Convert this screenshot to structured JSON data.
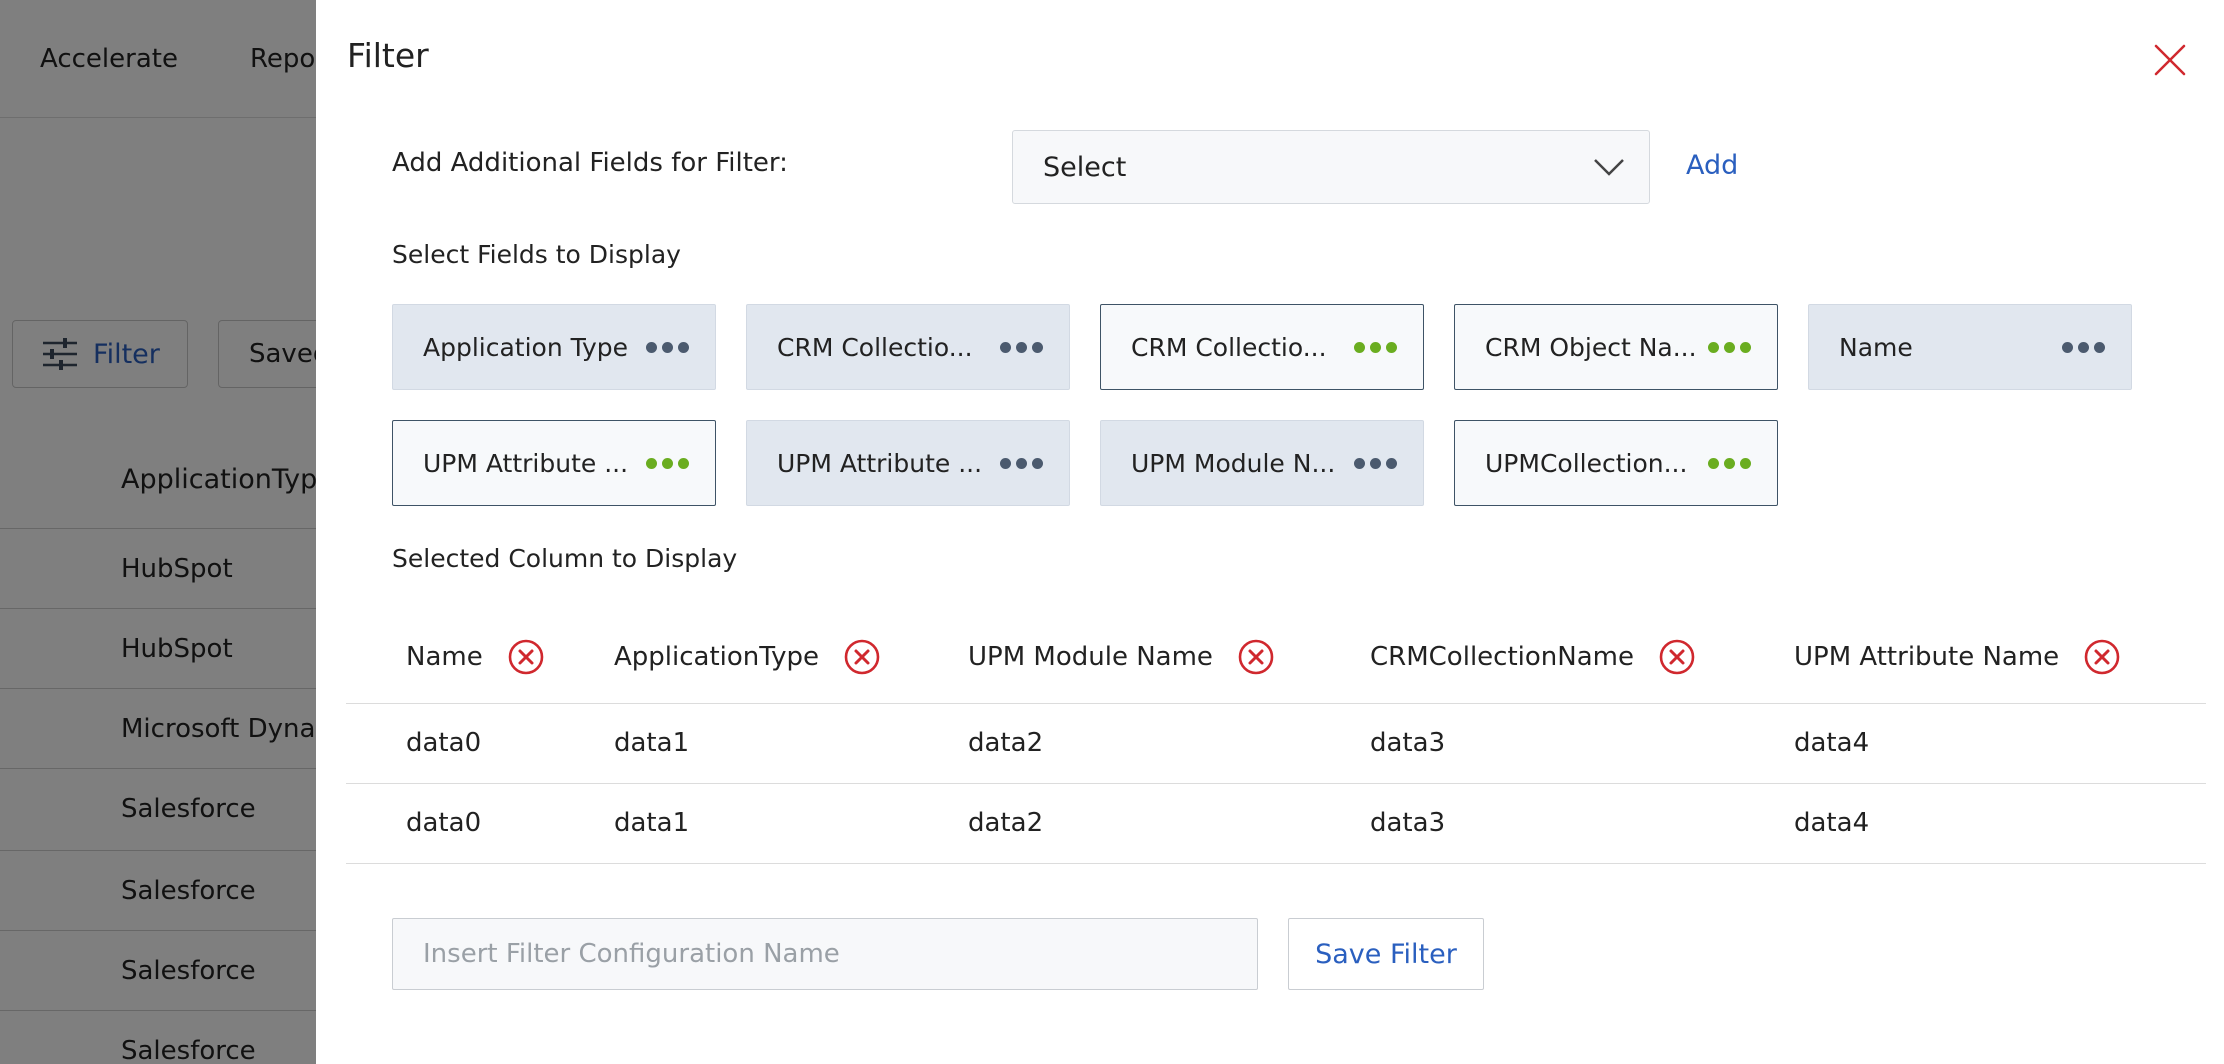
{
  "background": {
    "nav": [
      "Accelerate",
      "Repor"
    ],
    "filter_button": "Filter",
    "saved_button": "Saved",
    "column_header": "ApplicationType",
    "rows": [
      "HubSpot",
      "HubSpot",
      "Microsoft Dynar",
      "Salesforce",
      "Salesforce",
      "Salesforce",
      "Salesforce"
    ]
  },
  "drawer": {
    "title": "Filter",
    "add_fields_label": "Add Additional Fields for Filter:",
    "select_value": "Select",
    "add_link": "Add",
    "select_fields_label": "Select Fields to Display",
    "chips": [
      {
        "label": "Application Type",
        "selected": false
      },
      {
        "label": "CRM Collectio...",
        "selected": false
      },
      {
        "label": "CRM Collectio...",
        "selected": true
      },
      {
        "label": "CRM Object Na...",
        "selected": true
      },
      {
        "label": "Name",
        "selected": false
      },
      {
        "label": "UPM Attribute ...",
        "selected": true
      },
      {
        "label": "UPM Attribute ...",
        "selected": false
      },
      {
        "label": "UPM Module N...",
        "selected": false
      },
      {
        "label": "UPMCollection...",
        "selected": true
      }
    ],
    "selected_columns_label": "Selected Column to Display",
    "columns": [
      "Name",
      "ApplicationType",
      "UPM Module Name",
      "CRMCollectionName",
      "UPM Attribute Name"
    ],
    "rows": [
      [
        "data0",
        "data1",
        "data2",
        "data3",
        "data4"
      ],
      [
        "data0",
        "data1",
        "data2",
        "data3",
        "data4"
      ]
    ],
    "config_name_placeholder": "Insert Filter Configuration Name",
    "save_button": "Save Filter"
  },
  "colors": {
    "accent_blue": "#2a5fbf",
    "selected_dot": "#6aad20",
    "unselected_dot": "#4b5a6e",
    "remove_red": "#d0282e"
  }
}
